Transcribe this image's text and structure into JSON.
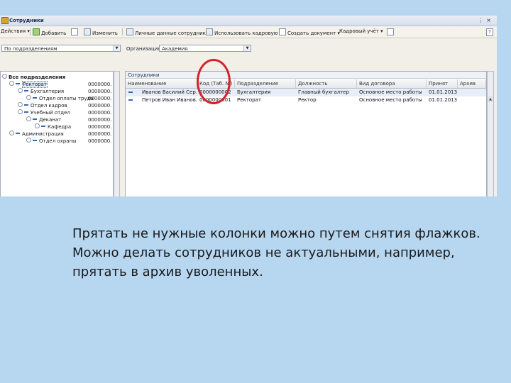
{
  "window": {
    "title": "Сотрудники"
  },
  "toolbar": {
    "actions": "Действия",
    "add": "Добавить",
    "edit": "Изменить",
    "personal_data": "Личные данные сотрудника",
    "use_personnel": "Использовать кадровую",
    "create_document": "Создать документ",
    "hr_accounting": "Кадровый учёт",
    "help": "?"
  },
  "left_panel": {
    "filter_value": "По подразделениям",
    "tree": [
      {
        "label": "Все подразделения",
        "code": "",
        "level": 0,
        "bold": true
      },
      {
        "label": "Ректорат",
        "code": "0000000.",
        "level": 1
      },
      {
        "label": "Бухгалтерия",
        "code": "0000000.",
        "level": 2
      },
      {
        "label": "Отдел оплаты труда",
        "code": "0000000.",
        "level": 3
      },
      {
        "label": "Отдел кадров",
        "code": "0000000.",
        "level": 2
      },
      {
        "label": "Учебный отдел",
        "code": "0000000.",
        "level": 2
      },
      {
        "label": "Деканат",
        "code": "0000000.",
        "level": 3
      },
      {
        "label": "Кафедра",
        "code": "0000000.",
        "level": 4
      },
      {
        "label": "Администрация",
        "code": "0000000.",
        "level": 1
      },
      {
        "label": "Отдел охраны",
        "code": "0000000.",
        "level": 3
      }
    ]
  },
  "right_panel": {
    "org_label": "Организация:",
    "org_value": "Академия",
    "grid_caption": "Сотрудники",
    "columns": [
      "Наименование",
      "Код (Таб. №)",
      "Подразделение",
      "Должность",
      "Вид договора",
      "Принят",
      "Архив"
    ],
    "rows": [
      {
        "name": "Иванов Василий Сер...",
        "code": "0000000002",
        "dept": "Бухгалтерия",
        "position": "Главный бухгалтер",
        "contract": "Основное место работы",
        "hired": "01.01.2013",
        "archive": ""
      },
      {
        "name": "Петров Иван Иванов...",
        "code": "0000000001",
        "dept": "Ректорат",
        "position": "Ректор",
        "contract": "Основное место работы",
        "hired": "01.01.2013",
        "archive": ""
      }
    ]
  },
  "caption": {
    "line1": "Прятать не нужные колонки можно путем снятия флажков.",
    "line2": "Можно делать сотрудников не актуальными, например, прятать в архив уволенных."
  },
  "colors": {
    "background": "#b7d7f1",
    "callout": "#d3232b"
  }
}
